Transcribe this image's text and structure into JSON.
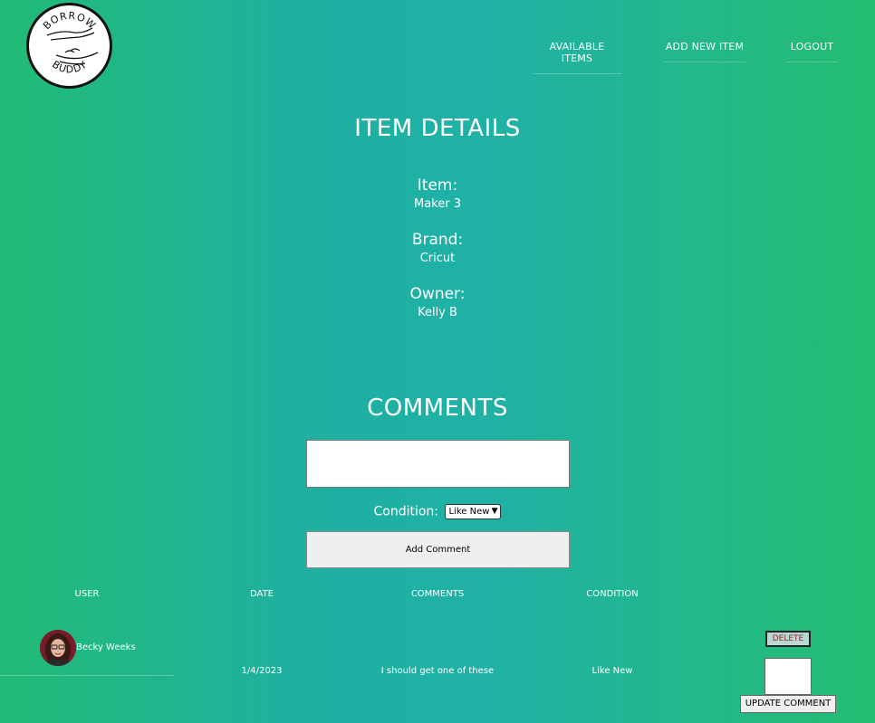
{
  "logo": {
    "top_text": "BORROW",
    "bottom_text": "BUDDY"
  },
  "nav": {
    "available_items": "AVAILABLE ITEMS",
    "add_new_item": "ADD NEW ITEM",
    "logout": "LOGOUT"
  },
  "item_details": {
    "heading": "ITEM DETAILS",
    "item_label": "Item:",
    "item_value": "Maker 3",
    "brand_label": "Brand:",
    "brand_value": "Cricut",
    "owner_label": "Owner:",
    "owner_value": "Kelly B"
  },
  "comments": {
    "heading": "COMMENTS",
    "comment_value": "",
    "condition_label": "Condition:",
    "condition_selected": "Like New",
    "add_button": "Add Comment"
  },
  "table": {
    "headers": [
      "USER",
      "DATE",
      "COMMENTS",
      "CONDITION"
    ],
    "rows": [
      {
        "user": "Becky Weeks",
        "date": "1/4/2023",
        "comment": "I should get one of these",
        "condition": "Like New",
        "delete_label": "DELETE",
        "update_label": "UPDATE COMMENT"
      }
    ]
  },
  "colors": {
    "bg_edge": "#21bb76",
    "bg_center": "#1fb0a2",
    "text": "#ffffff",
    "delete_text": "#8a2a2a"
  }
}
